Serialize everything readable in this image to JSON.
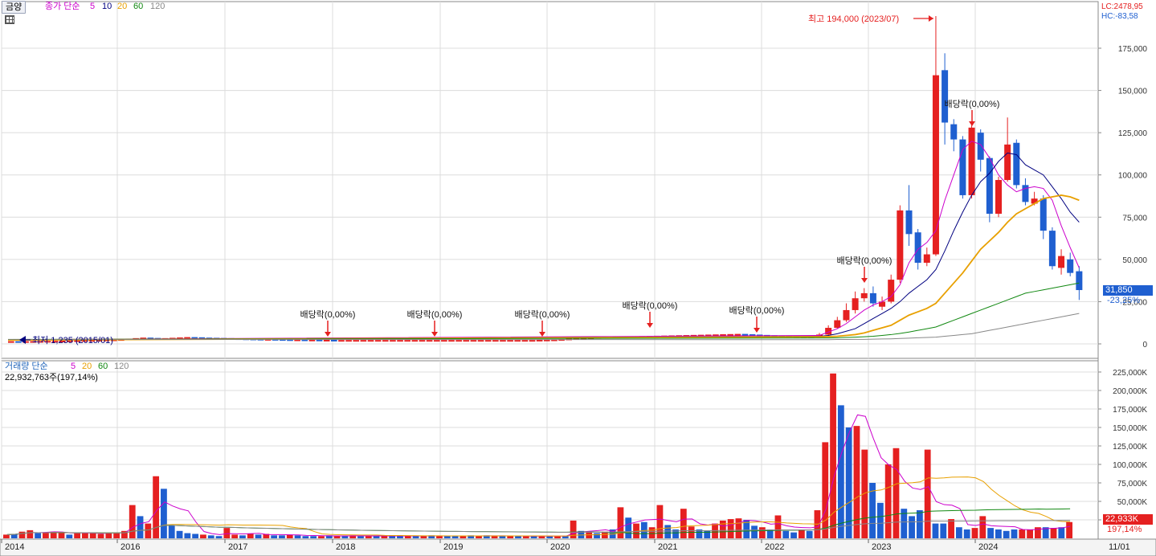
{
  "stock_button": "금양",
  "price_legend": {
    "label": "종가 단순",
    "ma": [
      "5",
      "10",
      "20",
      "60",
      "120"
    ],
    "colors": [
      "#cc00cc",
      "#000080",
      "#e8a000",
      "#118811",
      "#888888"
    ]
  },
  "volume_legend": {
    "label": "거래량 단순",
    "ma": [
      "5",
      "20",
      "60",
      "120"
    ],
    "colors": [
      "#cc00cc",
      "#e8a000",
      "#118811",
      "#888888"
    ],
    "summary": "22,932,763주(197,14%)"
  },
  "corner": {
    "lc": "LC:2478,95",
    "hc": "HC:-83,58"
  },
  "current_price": {
    "value": "31,850",
    "change": "-23,25%"
  },
  "current_volume": {
    "value": "22,933K",
    "change": "197,14%"
  },
  "annotations": {
    "high": "최고 194,000 (2023/07)",
    "low": "최저 1,235 (2015/01)",
    "dividend": "배당락(0,00%)"
  },
  "price_axis": [
    "175,000",
    "150,000",
    "125,000",
    "100,000",
    "75,000",
    "50,000",
    "25,000",
    "0"
  ],
  "volume_axis": [
    "225,000K",
    "200,000K",
    "175,000K",
    "150,000K",
    "125,000K",
    "100,000K",
    "75,000K",
    "50,000K",
    "25,000K"
  ],
  "x_axis": [
    "2014",
    "2016",
    "2017",
    "2018",
    "2019",
    "2020",
    "2021",
    "2022",
    "2023",
    "2024",
    "11/01"
  ],
  "colors": {
    "up": "#e52020",
    "down": "#1f5fd0",
    "grid": "#dcdcdc",
    "badge_price": "#1f5fd0",
    "badge_volume": "#e52020"
  },
  "chart_data": [
    {
      "type": "candlestick",
      "title": "",
      "period": "monthly",
      "ylim": [
        0,
        194000
      ],
      "series": [
        {
          "name": "종가 단순 5"
        },
        {
          "name": "10"
        },
        {
          "name": "20"
        },
        {
          "name": "60"
        },
        {
          "name": "120"
        }
      ],
      "candles": [
        {
          "x": "2022-06",
          "open": 4200,
          "close": 5500,
          "high": 6500,
          "low": 4000
        },
        {
          "x": "2022-07",
          "open": 5500,
          "close": 9500,
          "high": 11000,
          "low": 5000
        },
        {
          "x": "2022-08",
          "open": 9500,
          "close": 14000,
          "high": 16000,
          "low": 9000
        },
        {
          "x": "2022-09",
          "open": 14000,
          "close": 20000,
          "high": 24000,
          "low": 13000
        },
        {
          "x": "2022-10",
          "open": 20000,
          "close": 27000,
          "high": 31000,
          "low": 18000
        },
        {
          "x": "2022-11",
          "open": 27000,
          "close": 30000,
          "high": 33000,
          "low": 25000
        },
        {
          "x": "2022-12",
          "open": 30000,
          "close": 24000,
          "high": 34000,
          "low": 22000
        },
        {
          "x": "2023-01",
          "open": 22000,
          "close": 25000,
          "high": 28000,
          "low": 20000
        },
        {
          "x": "2023-02",
          "open": 25000,
          "close": 38000,
          "high": 41000,
          "low": 24000
        },
        {
          "x": "2023-03",
          "open": 38000,
          "close": 79000,
          "high": 82000,
          "low": 36000
        },
        {
          "x": "2023-04",
          "open": 79000,
          "close": 65000,
          "high": 94000,
          "low": 58000
        },
        {
          "x": "2023-05",
          "open": 66000,
          "close": 48000,
          "high": 68000,
          "low": 44000
        },
        {
          "x": "2023-06",
          "open": 48000,
          "close": 53000,
          "high": 57000,
          "low": 46000
        },
        {
          "x": "2023-07",
          "open": 53000,
          "close": 159000,
          "high": 194000,
          "low": 52000
        },
        {
          "x": "2023-08",
          "open": 162000,
          "close": 131000,
          "high": 172000,
          "low": 118000
        },
        {
          "x": "2023-09",
          "open": 130000,
          "close": 121000,
          "high": 133000,
          "low": 114000
        },
        {
          "x": "2023-10",
          "open": 121000,
          "close": 88000,
          "high": 123000,
          "low": 86000
        },
        {
          "x": "2023-11",
          "open": 88000,
          "close": 128000,
          "high": 130000,
          "low": 86000
        },
        {
          "x": "2023-12",
          "open": 125000,
          "close": 109000,
          "high": 127000,
          "low": 102000
        },
        {
          "x": "2024-01",
          "open": 110000,
          "close": 77000,
          "high": 111000,
          "low": 72000
        },
        {
          "x": "2024-02",
          "open": 77000,
          "close": 97000,
          "high": 99000,
          "low": 75000
        },
        {
          "x": "2024-03",
          "open": 97000,
          "close": 118000,
          "high": 134000,
          "low": 96000
        },
        {
          "x": "2024-04",
          "open": 119000,
          "close": 94000,
          "high": 121000,
          "low": 92000
        },
        {
          "x": "2024-05",
          "open": 94000,
          "close": 84000,
          "high": 98000,
          "low": 82000
        },
        {
          "x": "2024-06",
          "open": 83000,
          "close": 86000,
          "high": 90000,
          "low": 82000
        },
        {
          "x": "2024-07",
          "open": 86000,
          "close": 67000,
          "high": 88000,
          "low": 62000
        },
        {
          "x": "2024-08",
          "open": 67000,
          "close": 46000,
          "high": 69000,
          "low": 44000
        },
        {
          "x": "2024-09",
          "open": 45000,
          "close": 52000,
          "high": 56000,
          "low": 41000
        },
        {
          "x": "2024-10",
          "open": 50000,
          "close": 42000,
          "high": 54000,
          "low": 40000
        },
        {
          "x": "2024-11",
          "open": 43000,
          "close": 31850,
          "high": 46000,
          "low": 26000
        }
      ],
      "early_closes": [
        1300,
        1250,
        1300,
        1350,
        1400,
        1450,
        1500,
        1600,
        1700,
        1800,
        1900,
        2000,
        2100,
        2200,
        2300,
        2500,
        2800,
        3100,
        3400,
        3200,
        3000,
        3100,
        3300,
        3500,
        3700,
        3600,
        3400,
        3300,
        3200,
        3100,
        3000,
        2900,
        2800,
        2700,
        2600,
        2600,
        2500,
        2400,
        2300,
        2300,
        2200,
        2200,
        2100,
        2100,
        2000,
        2000,
        2000,
        2000,
        2000,
        2000,
        2000,
        2000,
        2000,
        2000,
        2000,
        2000,
        2000,
        2000,
        2000,
        2000,
        2000,
        2000,
        2000,
        2000,
        2000,
        2000,
        2000,
        2000,
        2000,
        2000,
        2000,
        2000,
        2100,
        2200,
        2300,
        2500,
        2800,
        3100,
        3300,
        3500,
        3700,
        3800,
        3900,
        4000,
        4100,
        4200,
        4300,
        4400,
        4500,
        4600,
        4700,
        4800,
        4900,
        5000,
        5100,
        5200,
        5300,
        5400,
        5500,
        5600,
        5400,
        5200,
        5000,
        4800,
        4600,
        4400,
        4300,
        4200,
        4100,
        4000
      ],
      "moving_averages": {
        "ma5": [
          5000,
          7000,
          9000,
          12000,
          16000,
          20000,
          23000,
          25000,
          28000,
          35000,
          48000,
          56000,
          60000,
          67000,
          85000,
          100000,
          115000,
          120000,
          118000,
          110000,
          100000,
          94000,
          90000,
          92000,
          93000,
          92000,
          85000,
          70000,
          57000,
          45000
        ],
        "ma10": [
          4500,
          5000,
          6000,
          7500,
          9000,
          12000,
          15000,
          18000,
          21000,
          25000,
          30000,
          34000,
          38000,
          44000,
          55000,
          67000,
          78000,
          88000,
          96000,
          101000,
          108000,
          113000,
          112000,
          106000,
          103000,
          100000,
          93000,
          86000,
          78000,
          72000
        ],
        "ma20": [
          4200,
          4300,
          4500,
          5000,
          5500,
          6500,
          8000,
          9500,
          11000,
          14000,
          17000,
          19000,
          21000,
          24000,
          30000,
          36000,
          42000,
          49000,
          56000,
          61000,
          66000,
          72000,
          77000,
          80000,
          83000,
          86000,
          87000,
          88000,
          87000,
          85000
        ],
        "ma60": [
          3500,
          3500,
          3600,
          3800,
          4000,
          4200,
          4500,
          5000,
          5500,
          6200,
          7000,
          8000,
          9000,
          10000,
          12000,
          14000,
          16000,
          18000,
          20000,
          22000,
          24000,
          26000,
          28000,
          30000,
          31000,
          32000,
          33000,
          34000,
          35000,
          36000
        ],
        "ma120": [
          2500,
          2500,
          2600,
          2600,
          2700,
          2700,
          2800,
          2900,
          3000,
          3200,
          3400,
          3600,
          3800,
          4000,
          4500,
          5000,
          5500,
          6000,
          7000,
          8000,
          9000,
          10000,
          11000,
          12000,
          13000,
          14000,
          15000,
          16000,
          17000,
          18000
        ]
      },
      "markers": [
        {
          "label": "최고 194,000 (2023/07)",
          "x": "2023-07",
          "y": 194000
        },
        {
          "label": "최저 1,235 (2015/01)",
          "x": "2015-01",
          "y": 1235
        },
        {
          "label": "배당락(0,00%)",
          "x": "2017-12"
        },
        {
          "label": "배당락(0,00%)",
          "x": "2018-12"
        },
        {
          "label": "배당락(0,00%)",
          "x": "2019-12"
        },
        {
          "label": "배당락(0,00%)",
          "x": "2020-12"
        },
        {
          "label": "배당락(0,00%)",
          "x": "2021-12"
        },
        {
          "label": "배당락(0,00%)",
          "x": "2022-12"
        },
        {
          "label": "배당락(0,00%)",
          "x": "2023-12"
        }
      ]
    },
    {
      "type": "bar",
      "title": "",
      "ylim": [
        0,
        235000
      ],
      "series": [
        {
          "name": "거래량 단순 5"
        },
        {
          "name": "20"
        },
        {
          "name": "60"
        },
        {
          "name": "120"
        }
      ],
      "unit": "K",
      "volumes": [
        5,
        6,
        9,
        11,
        7,
        8,
        9,
        8,
        5,
        7,
        8,
        7,
        6,
        7,
        8,
        10,
        45,
        30,
        20,
        84,
        67,
        18,
        10,
        7,
        6,
        5,
        4,
        3,
        14,
        5,
        4,
        6,
        5,
        6,
        4,
        4,
        5,
        4,
        3,
        3,
        3,
        4,
        3,
        3,
        4,
        3,
        3,
        3,
        3,
        4,
        3,
        3,
        3,
        3,
        4,
        3,
        3,
        3,
        3,
        4,
        3,
        4,
        3,
        3,
        3,
        3,
        3,
        3,
        3,
        3,
        3,
        3,
        24,
        10,
        8,
        7,
        9,
        12,
        42,
        28,
        20,
        22,
        15,
        45,
        18,
        12,
        40,
        16,
        12,
        10,
        20,
        24,
        26,
        27,
        25,
        17,
        15,
        12,
        31,
        10,
        8,
        12,
        10,
        38,
        130,
        223,
        180,
        150,
        152,
        120,
        75,
        48,
        100,
        122,
        40,
        30,
        38,
        120,
        20,
        20,
        26,
        15,
        12,
        14,
        30,
        14,
        12,
        10,
        12,
        12,
        12,
        15,
        15,
        14,
        15,
        22
      ],
      "volume_up": [
        1,
        0,
        1,
        1,
        0,
        1,
        1,
        1,
        0,
        1,
        1,
        1,
        1,
        1,
        1,
        1,
        1,
        0,
        1,
        1,
        0,
        0,
        0,
        0,
        0,
        1,
        0,
        0,
        1,
        1,
        0,
        1,
        0,
        1,
        0,
        0,
        1,
        0,
        0,
        0,
        1,
        0,
        1,
        0,
        1,
        0,
        1,
        0,
        1,
        0,
        0,
        1,
        0,
        1,
        0,
        1,
        0,
        0,
        1,
        0,
        1,
        0,
        1,
        0,
        1,
        0,
        1,
        0,
        1,
        0,
        1,
        0,
        1,
        0,
        1,
        0,
        1,
        0,
        1,
        0,
        1,
        0,
        1,
        1,
        0,
        0,
        1,
        1,
        0,
        0,
        1,
        1,
        1,
        1,
        0,
        0,
        1,
        0,
        1,
        0,
        0,
        1,
        0,
        1,
        1,
        1,
        0,
        0,
        1,
        1,
        0,
        0,
        1,
        1,
        0,
        0,
        0,
        1,
        0,
        0,
        1,
        0,
        0,
        1,
        1,
        0,
        0,
        0,
        0,
        1,
        1,
        1,
        0,
        1,
        0,
        1
      ]
    }
  ]
}
